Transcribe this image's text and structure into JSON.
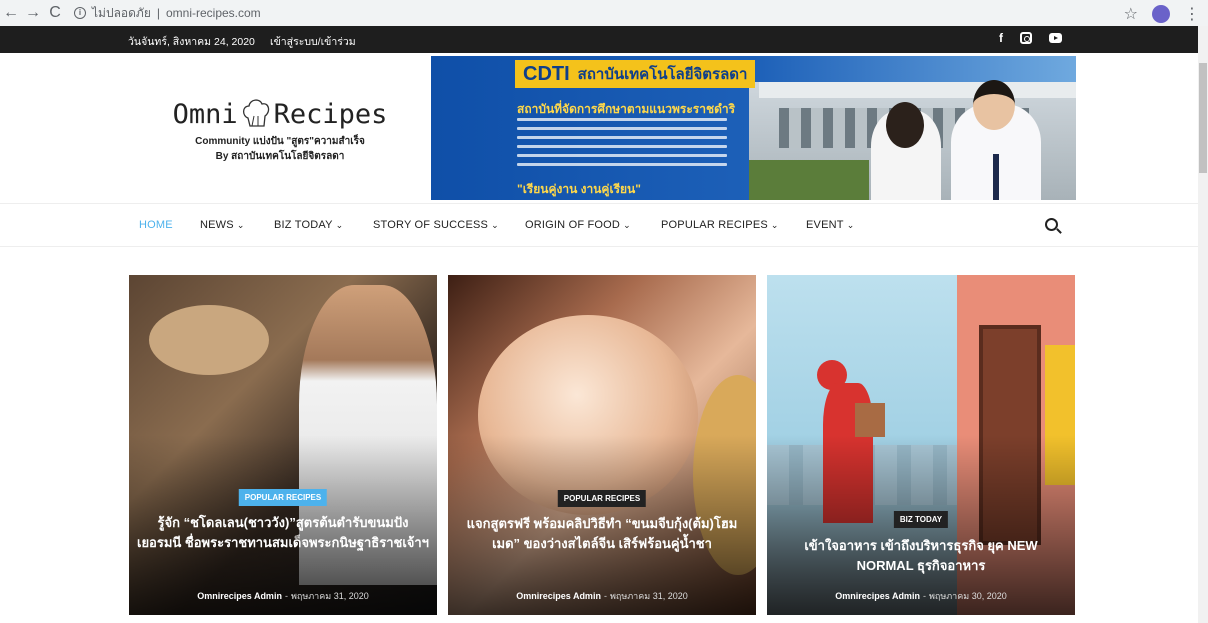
{
  "browser": {
    "info_icon": "i",
    "url_label": "ไม่ปลอดภัย",
    "url": "omni-recipes.com",
    "back": "←",
    "forward": "→",
    "reload": "C",
    "star": "☆",
    "menu": "⋮"
  },
  "topbar": {
    "date": "วันจันทร์, สิงหาคม 24, 2020",
    "login": "เข้าสู่ระบบ/เข้าร่วม",
    "social": [
      "facebook-icon",
      "instagram-icon",
      "youtube-icon"
    ],
    "facebook": "f"
  },
  "logo": {
    "left": "Omni",
    "right": "Recipes",
    "tagline1": "Community แบ่งปัน \"สูตร\"ความสำเร็จ",
    "tagline2": "By สถาบันเทคโนโลยีจิตรลดา"
  },
  "banner": {
    "brand": "CDTI",
    "institute": "สถาบันเทคโนโลยีจิตรลดา",
    "subtitle": "สถาบันที่จัดการศึกษาตามแนวพระราชดำริ",
    "slogan": "\"เรียนคู่งาน งานคู่เรียน\""
  },
  "nav": {
    "items": [
      {
        "label": "HOME",
        "dropdown": ""
      },
      {
        "label": "NEWS",
        "dropdown": "⌄"
      },
      {
        "label": "BIZ TODAY",
        "dropdown": "⌄"
      },
      {
        "label": "STORY OF SUCCESS",
        "dropdown": "⌄"
      },
      {
        "label": "ORIGIN OF FOOD",
        "dropdown": "⌄"
      },
      {
        "label": "POPULAR RECIPES",
        "dropdown": "⌄"
      },
      {
        "label": "EVENT",
        "dropdown": "⌄"
      }
    ],
    "accent": "#4db2ec"
  },
  "cards": [
    {
      "category": "POPULAR RECIPES",
      "title": "รู้จัก “ชโดลเลน(ชาววัง)”สูตรต้นตำรับขนมปังเยอรมนี ชื่อพระราชทานสมเด็จพระกนิษฐาธิราชเจ้าฯ",
      "author": "Omnirecipes Admin",
      "separator": "-",
      "date": "พฤษภาคม 31, 2020"
    },
    {
      "category": "POPULAR RECIPES",
      "title": "แจกสูตรฟรี พร้อมคลิปวิธีทำ “ขนมจีบกุ้ง(ต้ม)โฮมเมด” ของว่างสไตล์จีน เสิร์ฟร้อนคู่น้ำชา",
      "author": "Omnirecipes Admin",
      "separator": "-",
      "date": "พฤษภาคม 31, 2020"
    },
    {
      "category": "BIZ TODAY",
      "title": "เข้าใจอาหาร เข้าถึงบริหารธุรกิจ ยุค NEW NORMAL ธุรกิจอาหาร",
      "author": "Omnirecipes Admin",
      "separator": "-",
      "date": "พฤษภาคม 30, 2020"
    }
  ]
}
